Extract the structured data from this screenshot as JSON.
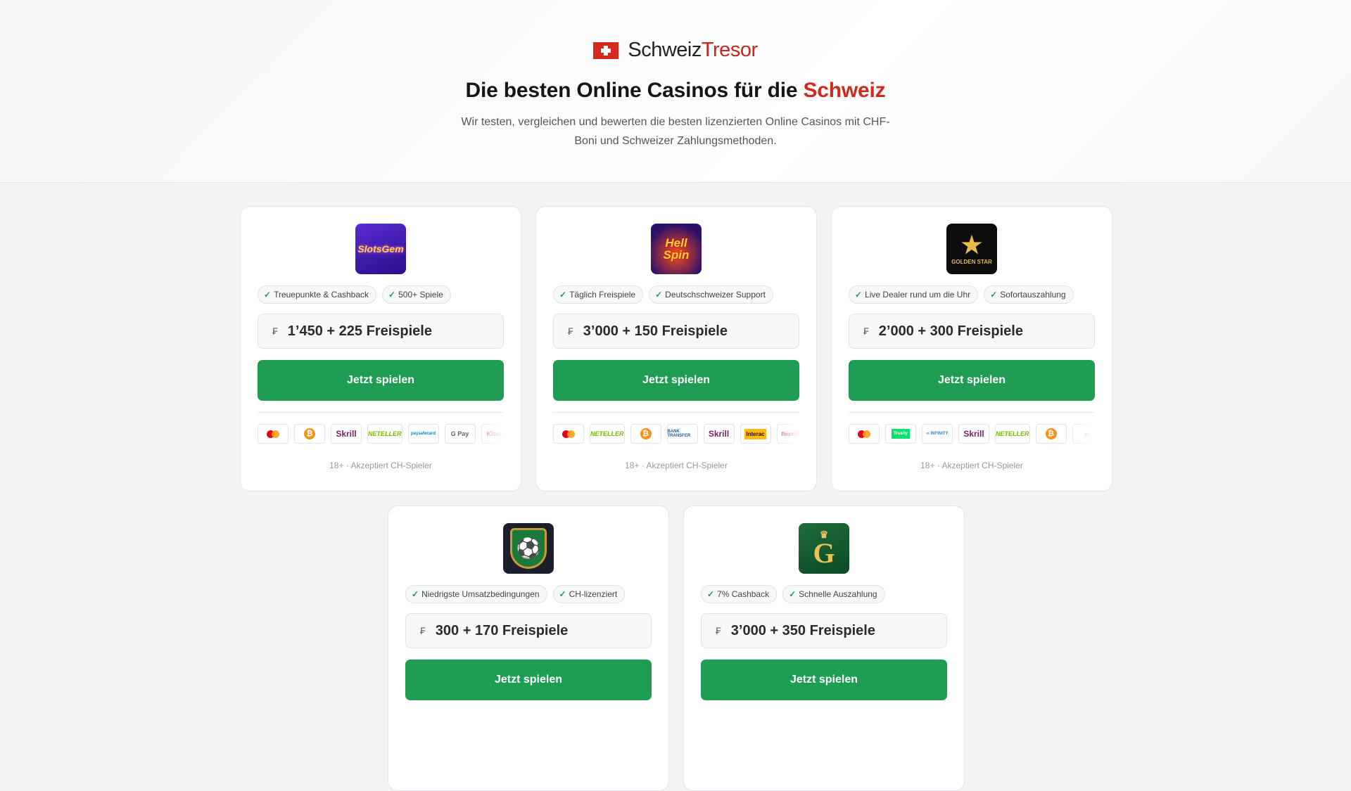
{
  "header": {
    "brand_part1": "Schweiz",
    "brand_part2": "Tresor",
    "headline": "Die besten Online Casinos für die ",
    "headline_accent": "Schweiz",
    "subtitle": "Wir testen, vergleichen und bewerten die besten lizenzierten Online Casinos mit CHF-Boni und Schweizer Zahlungsmethoden."
  },
  "cta_label": "Jetzt spielen",
  "currency_symbol": "₣",
  "disclaimer": "18+ · Akzeptiert CH-Spieler",
  "casinos": [
    {
      "logo_text": "SlotsGem",
      "features": [
        "Treuepunkte & Cashback",
        "500+ Spiele"
      ],
      "bonus": "1’450 + 225 Freispiele",
      "payments": [
        "Mastercard",
        "Bitcoin",
        "Skrill",
        "Neteller",
        "paysafecard",
        "G Pay",
        "Klarna"
      ]
    },
    {
      "logo_text": "Hell Spin",
      "features": [
        "Täglich Freispiele",
        "Deutschschweizer Support"
      ],
      "bonus": "3’000 + 150 Freispiele",
      "payments": [
        "Mastercard",
        "Neteller",
        "Bitcoin",
        "Bank Transfer",
        "Skrill",
        "Interac",
        "Flexepin"
      ]
    },
    {
      "logo_text": "GOLDEN STAR",
      "features": [
        "Live Dealer rund um die Uhr",
        "Sofortauszahlung"
      ],
      "bonus": "2’000 + 300 Freispiele",
      "payments": [
        "Mastercard",
        "Trustly",
        "Infinity",
        "Skrill",
        "Neteller",
        "Bitcoin",
        "Voucher"
      ]
    },
    {
      "logo_text": "⚽",
      "features": [
        "Niedrigste Umsatzbedingungen",
        "CH-lizenziert"
      ],
      "bonus": "300 + 170 Freispiele"
    },
    {
      "logo_text": "G",
      "features": [
        "7% Cashback",
        "Schnelle Auszahlung"
      ],
      "bonus": "3’000 + 350 Freispiele"
    }
  ]
}
